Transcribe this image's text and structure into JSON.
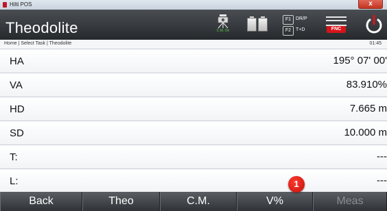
{
  "os_window": {
    "title": "Hilti POS",
    "close_glyph": "x"
  },
  "header": {
    "title": "Theodolite",
    "cm_label": "C.M. On",
    "fkeys": [
      {
        "key": "F1",
        "label": "DR/P"
      },
      {
        "key": "F2",
        "label": "T+D"
      }
    ],
    "fnc_label": "FNC",
    "icons": [
      "instrument-cm-icon",
      "battery-icon",
      "fnc-menu-icon",
      "power-icon"
    ],
    "accent_color": "#d8141a"
  },
  "breadcrumb": {
    "path": "Home | Select Task | Theodolite",
    "time": "01:45"
  },
  "measurements": [
    {
      "label": "HA",
      "value": "195° 07' 00'"
    },
    {
      "label": "VA",
      "value": "83.910%"
    },
    {
      "label": "HD",
      "value": "7.665 m"
    },
    {
      "label": "SD",
      "value": "10.000 m"
    },
    {
      "label": "T:",
      "value": "---"
    },
    {
      "label": "L:",
      "value": "---"
    }
  ],
  "softkeys": [
    {
      "label": "Back"
    },
    {
      "label": "Theo"
    },
    {
      "label": "C.M."
    },
    {
      "label": "V%"
    },
    {
      "label": "Meas"
    }
  ],
  "callout": "1"
}
